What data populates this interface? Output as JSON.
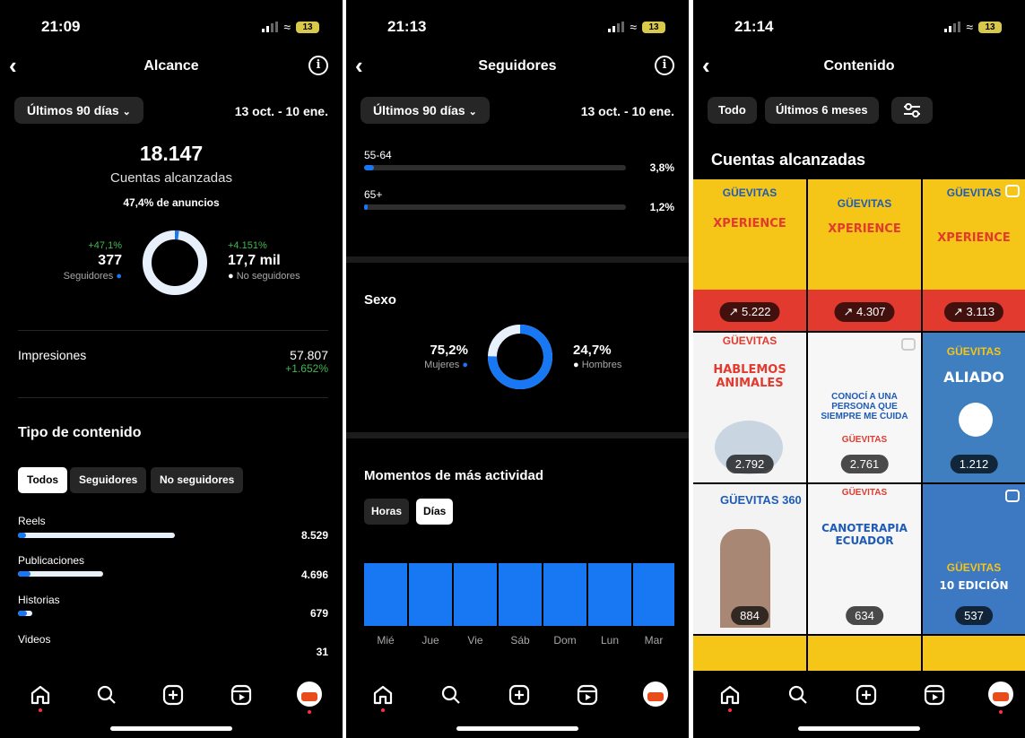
{
  "screens": [
    {
      "time": "21:09",
      "battery": "13",
      "title": "Alcance",
      "period": "Últimos 90 días",
      "range": "13 oct. - 10 ene.",
      "total": "18.147",
      "total_label": "Cuentas alcanzadas",
      "ads_share": "47,4% de anuncios",
      "followers": {
        "change": "+47,1%",
        "value": "377",
        "label": "Seguidores"
      },
      "nonfollowers": {
        "change": "+4.151%",
        "value": "17,7 mil",
        "label": "No seguidores"
      },
      "impressions": {
        "label": "Impresiones",
        "value": "57.807",
        "change": "+1.652%"
      },
      "content_type_title": "Tipo de contenido",
      "filters": [
        "Todos",
        "Seguidores",
        "No seguidores"
      ],
      "content_types": [
        {
          "label": "Reels",
          "value": "8.529",
          "fraction": 0.97
        },
        {
          "label": "Publicaciones",
          "value": "4.696",
          "fraction": 0.53
        },
        {
          "label": "Historias",
          "value": "679",
          "fraction": 0.09
        },
        {
          "label": "Videos",
          "value": "31",
          "fraction": 0.0
        }
      ]
    },
    {
      "time": "21:13",
      "battery": "13",
      "title": "Seguidores",
      "period": "Últimos 90 días",
      "range": "13 oct. - 10 ene.",
      "age_groups": [
        {
          "label": "55-64",
          "value": "3,8%",
          "fraction": 0.038
        },
        {
          "label": "65+",
          "value": "1,2%",
          "fraction": 0.012
        }
      ],
      "gender_title": "Sexo",
      "women": {
        "value": "75,2%",
        "label": "Mujeres"
      },
      "men": {
        "value": "24,7%",
        "label": "Hombres"
      },
      "activity_title": "Momentos de más actividad",
      "activity_tabs": [
        "Horas",
        "Días"
      ],
      "days": [
        "Mié",
        "Jue",
        "Vie",
        "Sáb",
        "Dom",
        "Lun",
        "Mar"
      ]
    },
    {
      "time": "21:14",
      "battery": "13",
      "title": "Contenido",
      "filters": [
        "Todo",
        "Últimos 6 meses"
      ],
      "section": "Cuentas alcanzadas",
      "thumbs": [
        {
          "title": "XPERIENCE",
          "brand": "GÜEVITAS",
          "count": "5.222",
          "trend": true,
          "bg": "#f5c518"
        },
        {
          "title": "XPERIENCE",
          "brand": "GÜEVITAS",
          "count": "4.307",
          "trend": true,
          "bg": "#f5c518"
        },
        {
          "title": "XPERIENCE",
          "brand": "GÜEVITAS",
          "count": "3.113",
          "trend": true,
          "bg": "#f5c518"
        },
        {
          "title": "HABLEMOS ANIMALES",
          "brand": "GÜEVITAS",
          "count": "2.792",
          "trend": false,
          "bg": "#f4f4f4"
        },
        {
          "title": "CONOCÍ A UNA PERSONA QUE SIEMPRE ME CUIDA",
          "brand": "GÜEVITAS",
          "count": "2.761",
          "trend": false,
          "bg": "#f7f7f7"
        },
        {
          "title": "ALIADO",
          "brand": "GÜEVITAS",
          "count": "1.212",
          "trend": false,
          "bg": "#3f7fbf"
        },
        {
          "title": "GÜEVITAS 360",
          "brand": "GÜEVITAS",
          "count": "884",
          "trend": false,
          "bg": "#f3f3f3"
        },
        {
          "title": "CANOTERAPIA ECUADOR",
          "brand": "GÜEVITAS",
          "count": "634",
          "trend": false,
          "bg": "#f6f6f6"
        },
        {
          "title": "10 EDICIÓN",
          "brand": "GÜEVITAS",
          "count": "537",
          "trend": false,
          "bg": "#3c79c2"
        }
      ]
    }
  ],
  "colors": {
    "accent": "#1877f2",
    "positive": "#3fb950",
    "ring_light": "#e8f1fb",
    "background": "#000000"
  },
  "icons": [
    "home-icon",
    "search-icon",
    "create-icon",
    "reels-icon",
    "profile-avatar"
  ]
}
